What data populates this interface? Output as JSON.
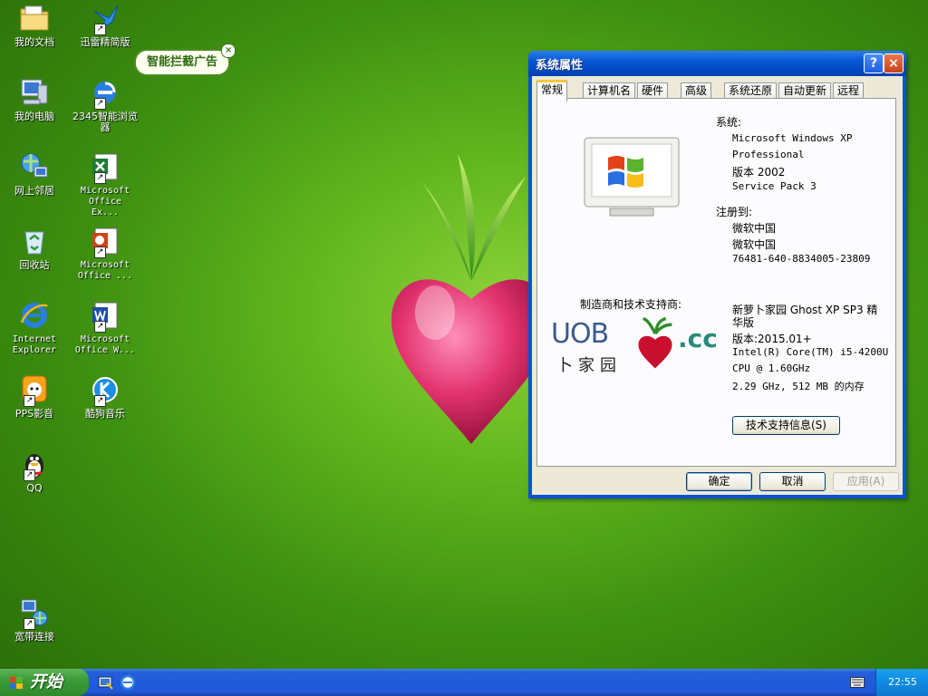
{
  "desktop": {
    "icons": [
      {
        "label": "我的文档",
        "icon": "my-documents-icon",
        "shortcut": false
      },
      {
        "label": "我的电脑",
        "icon": "my-computer-icon",
        "shortcut": false
      },
      {
        "label": "网上邻居",
        "icon": "network-places-icon",
        "shortcut": false
      },
      {
        "label": "回收站",
        "icon": "recycle-bin-icon",
        "shortcut": false
      },
      {
        "label": "Internet\nExplorer",
        "icon": "internet-explorer-icon",
        "shortcut": false
      },
      {
        "label": "PPS影音",
        "icon": "pps-icon",
        "shortcut": true
      },
      {
        "label": "QQ",
        "icon": "qq-icon",
        "shortcut": true
      },
      {
        "label": "宽带连接",
        "icon": "broadband-icon",
        "shortcut": true
      },
      {
        "label": "迅雷精简版",
        "icon": "thunder-icon",
        "shortcut": true
      },
      {
        "label": "2345智能浏览\n器",
        "icon": "browser-2345-icon",
        "shortcut": true
      },
      {
        "label": "Microsoft\nOffice Ex...",
        "icon": "excel-icon",
        "shortcut": true
      },
      {
        "label": "Microsoft\nOffice ...",
        "icon": "powerpoint-icon",
        "shortcut": true
      },
      {
        "label": "Microsoft\nOffice W...",
        "icon": "word-icon",
        "shortcut": true
      },
      {
        "label": "酷狗音乐",
        "icon": "kugou-icon",
        "shortcut": true
      }
    ],
    "balloon": {
      "text": "智能拦截广告",
      "close": "×"
    }
  },
  "dialog": {
    "title": "系统属性",
    "help": "?",
    "close": "×",
    "tabs": [
      "常规",
      "计算机名",
      "硬件",
      "高级",
      "系统还原",
      "自动更新",
      "远程"
    ],
    "active_tab": "常规",
    "system_heading": "系统:",
    "system_lines": [
      "Microsoft Windows XP",
      "Professional",
      "版本 2002",
      "Service Pack 3"
    ],
    "registered_heading": "注册到:",
    "registered_lines": [
      "微软中国",
      "微软中国",
      "76481-640-8834005-23809"
    ],
    "oem_heading": "制造商和技术支持商:",
    "oem_line1": "新萝卜家园 Ghost XP SP3 精",
    "oem_line2": "华版",
    "oem_lines": [
      "版本:2015.01+",
      "Intel(R) Core(TM) i5-4200U",
      "CPU @ 1.60GHz",
      "2.29 GHz, 512 MB 的内存"
    ],
    "oem_logo_text": "UOB",
    "oem_logo_sub": "卜家园",
    "oem_logo_cc": ".cc",
    "support_button": "技术支持信息(S)",
    "ok": "确定",
    "cancel": "取消",
    "apply": "应用(A)"
  },
  "taskbar": {
    "start": "开始",
    "clock": "22:55"
  },
  "colors": {
    "taskbar_blue": "#245edb",
    "start_green": "#3b9c37",
    "dialog_face": "#ece9d8",
    "tab_highlight": "#ffc83c"
  }
}
